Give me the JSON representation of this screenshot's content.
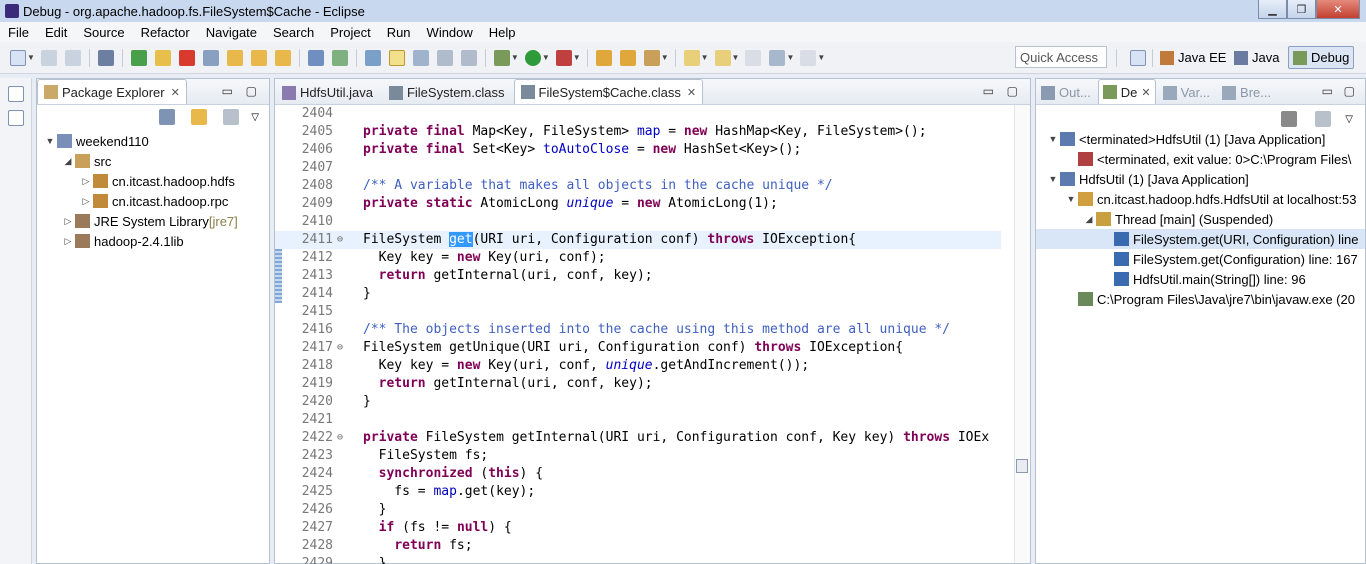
{
  "window": {
    "title": "Debug - org.apache.hadoop.fs.FileSystem$Cache - Eclipse"
  },
  "menu": [
    "File",
    "Edit",
    "Source",
    "Refactor",
    "Navigate",
    "Search",
    "Project",
    "Run",
    "Window",
    "Help"
  ],
  "toolbar": {
    "quick_access_placeholder": "Quick Access",
    "perspectives": [
      {
        "label": "Java EE"
      },
      {
        "label": "Java"
      },
      {
        "label": "Debug",
        "active": true
      }
    ]
  },
  "package_explorer": {
    "tab_label": "Package Explorer",
    "tree": [
      {
        "label": "weekend110",
        "level": 0,
        "twisty": "▼",
        "icon": "project-icon"
      },
      {
        "label": "src",
        "level": 1,
        "twisty": "◢",
        "icon": "source-folder-icon"
      },
      {
        "label": "cn.itcast.hadoop.hdfs",
        "level": 2,
        "twisty": "▷",
        "icon": "package-icon"
      },
      {
        "label": "cn.itcast.hadoop.rpc",
        "level": 2,
        "twisty": "▷",
        "icon": "package-icon"
      },
      {
        "label": "JRE System Library",
        "suffix": "[jre7]",
        "level": 1,
        "twisty": "▷",
        "icon": "library-icon"
      },
      {
        "label": "hadoop-2.4.1lib",
        "level": 1,
        "twisty": "▷",
        "icon": "library-icon"
      }
    ]
  },
  "editor": {
    "tabs": [
      {
        "label": "HdfsUtil.java",
        "active": false
      },
      {
        "label": "FileSystem.class",
        "active": false
      },
      {
        "label": "FileSystem$Cache.class",
        "active": true
      }
    ],
    "lines": [
      {
        "n": "2404",
        "html": ""
      },
      {
        "n": "2405",
        "html": "<span class='kw'>private final</span> Map&lt;Key, FileSystem&gt; <span class='fld'>map</span> = <span class='kw'>new</span> HashMap&lt;Key, FileSystem&gt;();"
      },
      {
        "n": "2406",
        "html": "<span class='kw'>private final</span> Set&lt;Key&gt; <span class='fld'>toAutoClose</span> = <span class='kw'>new</span> HashSet&lt;Key&gt;();"
      },
      {
        "n": "2407",
        "html": ""
      },
      {
        "n": "2408",
        "html": "<span class='cmt'>/** A variable that makes all objects in the cache unique */</span>"
      },
      {
        "n": "2409",
        "html": "<span class='kw'>private static</span> AtomicLong <span class='sfld'>unique</span> = <span class='kw'>new</span> AtomicLong(1);"
      },
      {
        "n": "2410",
        "html": ""
      },
      {
        "n": "2411",
        "fold": "⊖",
        "current": true,
        "html": "FileSystem <span class='hl'>get</span>(URI uri, Configuration conf) <span class='kw'>throws</span> IOException{"
      },
      {
        "n": "2412",
        "html": "  Key key = <span class='kw'>new</span> Key(uri, conf);"
      },
      {
        "n": "2413",
        "html": "  <span class='kw'>return</span> getInternal(uri, conf, key);"
      },
      {
        "n": "2414",
        "html": "}"
      },
      {
        "n": "2415",
        "html": ""
      },
      {
        "n": "2416",
        "html": "<span class='cmt'>/** The objects inserted into the cache using this method are all unique */</span>"
      },
      {
        "n": "2417",
        "fold": "⊖",
        "html": "FileSystem getUnique(URI uri, Configuration conf) <span class='kw'>throws</span> IOException{"
      },
      {
        "n": "2418",
        "html": "  Key key = <span class='kw'>new</span> Key(uri, conf, <span class='sfld'>unique</span>.getAndIncrement());"
      },
      {
        "n": "2419",
        "html": "  <span class='kw'>return</span> getInternal(uri, conf, key);"
      },
      {
        "n": "2420",
        "html": "}"
      },
      {
        "n": "2421",
        "html": ""
      },
      {
        "n": "2422",
        "fold": "⊖",
        "html": "<span class='kw'>private</span> FileSystem getInternal(URI uri, Configuration conf, Key key) <span class='kw'>throws</span> IOEx"
      },
      {
        "n": "2423",
        "html": "  FileSystem fs;"
      },
      {
        "n": "2424",
        "html": "  <span class='kw'>synchronized</span> (<span class='kw'>this</span>) {"
      },
      {
        "n": "2425",
        "html": "    fs = <span class='fld'>map</span>.get(key);"
      },
      {
        "n": "2426",
        "html": "  }"
      },
      {
        "n": "2427",
        "html": "  <span class='kw'>if</span> (fs != <span class='kw'>null</span>) {"
      },
      {
        "n": "2428",
        "html": "    <span class='kw'>return</span> fs;"
      },
      {
        "n": "2429",
        "html": "  }"
      }
    ]
  },
  "debug_view": {
    "tabs": [
      {
        "label": "Out...",
        "active": false
      },
      {
        "label": "De",
        "active": true
      },
      {
        "label": "Var...",
        "active": false
      },
      {
        "label": "Bre...",
        "active": false
      }
    ],
    "tree": [
      {
        "label": "<terminated>HdfsUtil (1) [Java Application]",
        "level": 0,
        "twisty": "▼",
        "icon": "launch-icon"
      },
      {
        "label": "<terminated, exit value: 0>C:\\Program Files\\",
        "level": 1,
        "twisty": "",
        "icon": "terminated-process-icon"
      },
      {
        "label": "HdfsUtil (1) [Java Application]",
        "level": 0,
        "twisty": "▼",
        "icon": "launch-icon"
      },
      {
        "label": "cn.itcast.hadoop.hdfs.HdfsUtil at localhost:53",
        "level": 1,
        "twisty": "▼",
        "icon": "debug-target-icon"
      },
      {
        "label": "Thread [main] (Suspended)",
        "level": 2,
        "twisty": "◢",
        "icon": "thread-icon"
      },
      {
        "label": "FileSystem.get(URI, Configuration) line",
        "level": 3,
        "twisty": "",
        "icon": "stack-frame-icon",
        "selected": true
      },
      {
        "label": "FileSystem.get(Configuration) line: 167",
        "level": 3,
        "twisty": "",
        "icon": "stack-frame-icon"
      },
      {
        "label": "HdfsUtil.main(String[]) line: 96",
        "level": 3,
        "twisty": "",
        "icon": "stack-frame-icon"
      },
      {
        "label": "C:\\Program Files\\Java\\jre7\\bin\\javaw.exe (20",
        "level": 1,
        "twisty": "",
        "icon": "process-icon"
      }
    ]
  },
  "colors": {
    "keyword": "#7f0055",
    "field": "#0000c0",
    "comment": "#3f5fbf",
    "current_line": "#e8f2fe",
    "selection": "#3399ff"
  }
}
